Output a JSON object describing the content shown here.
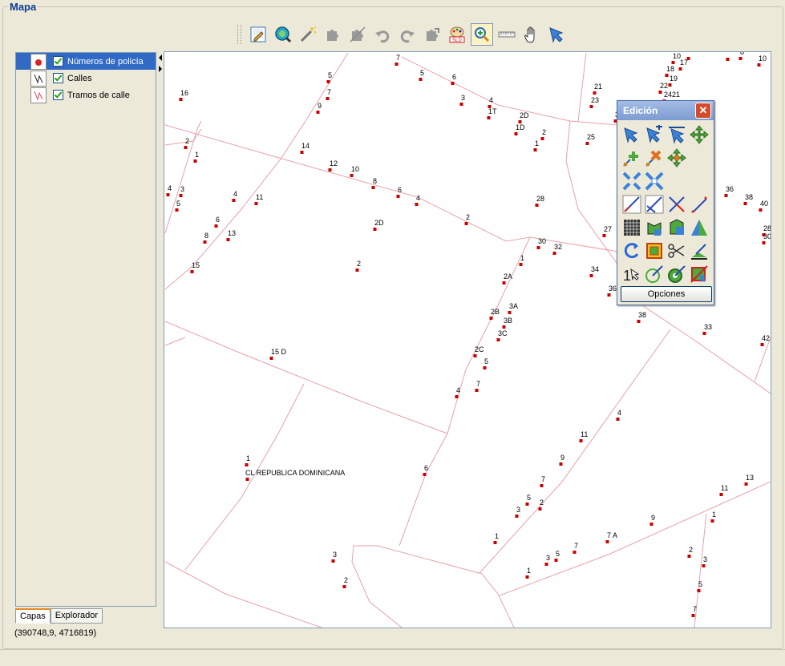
{
  "panel_title": "Mapa",
  "toolbar": {
    "buttons": [
      {
        "name": "edit-layer",
        "icon": "edit-pencil-icon"
      },
      {
        "name": "zoom-all",
        "icon": "globe-zoom-icon"
      },
      {
        "name": "magic-wand",
        "icon": "magic-wand-icon"
      },
      {
        "name": "puzzle-a",
        "icon": "puzzle-icon"
      },
      {
        "name": "puzzle-b",
        "icon": "puzzle-icon"
      },
      {
        "name": "undo",
        "icon": "undo-icon"
      },
      {
        "name": "redo",
        "icon": "redo-icon"
      },
      {
        "name": "puzzle-c",
        "icon": "puzzle-icon"
      },
      {
        "name": "sld-style",
        "icon": "sld-palette-icon",
        "label": "SLD"
      },
      {
        "name": "zoom-in",
        "icon": "magnifier-plus-icon",
        "active": true
      },
      {
        "name": "measure",
        "icon": "ruler-icon"
      },
      {
        "name": "pan",
        "icon": "hand-icon"
      },
      {
        "name": "select",
        "icon": "arrow-cursor-icon"
      }
    ]
  },
  "layers": [
    {
      "label": "Números de policía",
      "selected": true,
      "checked": true,
      "icon": "point-layer-icon"
    },
    {
      "label": "Calles",
      "selected": false,
      "checked": true,
      "icon": "line-layer-icon"
    },
    {
      "label": "Tramos de calle",
      "selected": false,
      "checked": true,
      "icon": "line-layer-icon"
    }
  ],
  "tabs": [
    {
      "label": "Capas",
      "active": true
    },
    {
      "label": "Explorador",
      "active": false
    }
  ],
  "edit_window": {
    "title": "Edición",
    "options_label": "Opciones"
  },
  "map": {
    "street_label": "CL REPUBLICA DOMINICANA",
    "point_color": "#cc0000",
    "line_color": "#e8a0a8"
  },
  "coordinates": "(390748,9, 4716819)",
  "colors": {
    "accent": "#316ac5",
    "title": "#0b3d91"
  }
}
